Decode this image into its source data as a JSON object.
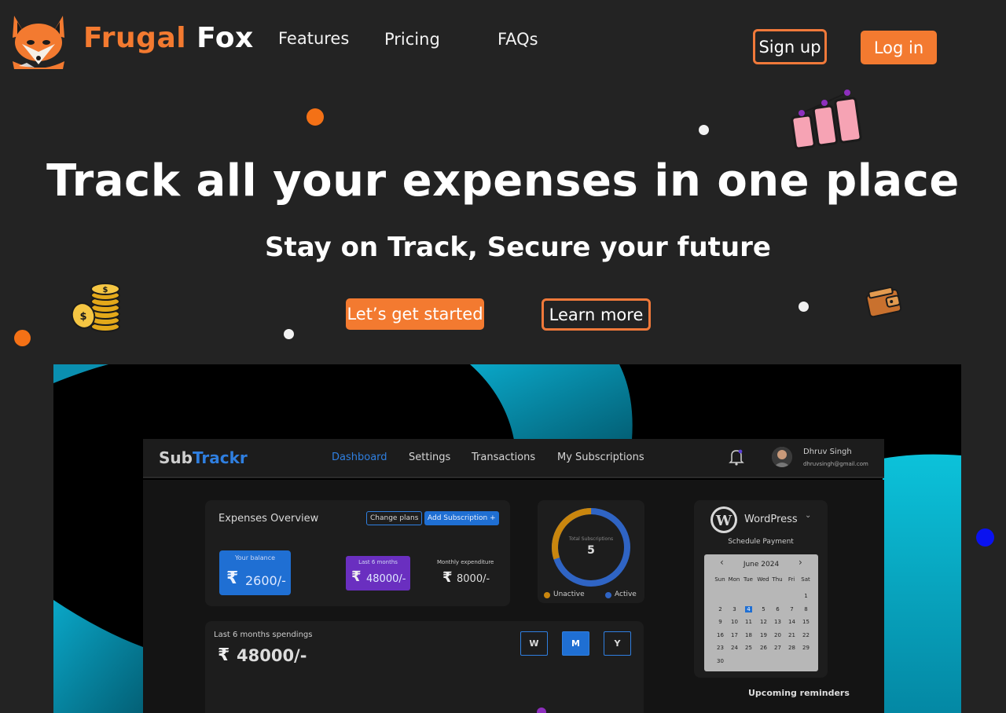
{
  "brand": {
    "name_part1": "Frugal",
    "name_part2": "Fox"
  },
  "nav": {
    "links": [
      {
        "label": "Features"
      },
      {
        "label": "Pricing"
      },
      {
        "label": "FAQs"
      }
    ],
    "signup_label": "Sign up",
    "login_label": "Log in"
  },
  "hero": {
    "title": "Track all your expenses in one place",
    "subtitle": "Stay on Track, Secure your future",
    "cta_primary": "Let’s get started",
    "cta_secondary": "Learn more"
  },
  "colors": {
    "accent": "#f37a30",
    "background": "#232323",
    "app_blue": "#1f6fd3"
  },
  "preview": {
    "app_name_part1": "Sub",
    "app_name_part2": "Trackr",
    "nav": [
      "Dashboard",
      "Settings",
      "Transactions",
      "My Subscriptions"
    ],
    "active_nav": "Dashboard",
    "user": {
      "name": "Dhruv Singh",
      "email": "dhruvsingh@gmail.com"
    },
    "expenses": {
      "title": "Expenses Overview",
      "change_plans": "Change plans",
      "add_subscription": "Add Subscription +",
      "balance_label": "Your balance",
      "balance_value": "2600/-",
      "six_months_label": "Last 6 months",
      "six_months_value": "48000/-",
      "monthly_label": "Monthly expenditure",
      "monthly_value": "8000/-"
    },
    "subscriptions": {
      "center_label": "Total Subscriptions",
      "total": "5",
      "legend_inactive": "Unactive",
      "legend_active": "Active",
      "inactive_fraction": 0.3,
      "inactive_color": "#c9860e",
      "active_color": "#2f64c4"
    },
    "spendings": {
      "label": "Last 6 months spendings",
      "value": "48000/-",
      "periods": [
        "W",
        "M",
        "Y"
      ],
      "selected_period": "M"
    },
    "payment": {
      "service": "WordPress",
      "schedule_label": "Schedule Payment",
      "month": "June 2024",
      "weekdays": [
        "Sun",
        "Mon",
        "Tue",
        "Wed",
        "Thu",
        "Fri",
        "Sat"
      ],
      "weeks": [
        [
          "",
          "",
          "",
          "",
          "",
          "",
          "1"
        ],
        [
          "2",
          "3",
          "4",
          "5",
          "6",
          "7",
          "8"
        ],
        [
          "9",
          "10",
          "11",
          "12",
          "13",
          "14",
          "15"
        ],
        [
          "16",
          "17",
          "18",
          "19",
          "20",
          "21",
          "22"
        ],
        [
          "23",
          "24",
          "25",
          "26",
          "27",
          "28",
          "29"
        ],
        [
          "30",
          "",
          "",
          "",
          "",
          "",
          ""
        ]
      ],
      "selected_day": "4",
      "reminders_label": "Upcoming reminders"
    }
  },
  "icons": {
    "rupee": "₹",
    "prev": "‹",
    "next": "›",
    "dropdown": "⌄"
  }
}
